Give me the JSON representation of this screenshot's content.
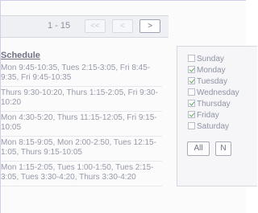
{
  "pager": {
    "range": "1 - 15",
    "first_icon": "double-chevron-left-icon",
    "prev_icon": "chevron-left-icon",
    "next_icon": "chevron-right-icon",
    "first_label": "<<",
    "prev_label": "<",
    "next_label": ">"
  },
  "schedule": {
    "header": "Schedule",
    "rows": [
      "Mon 9:45-10:35, Tues 2:15-3:05, Fri 8:45-9:35, Fri 9:45-10:35",
      "Thurs 9:30-10:20, Thurs 1:15-2:05, Fri 9:30-10:20",
      "Mon 4:30-5:20, Thurs 11:15-12:05, Fri 9:15-10:05",
      "Mon 8:15-9:05, Mon 2:00-2:50, Tues 12:15-1:05, Thurs 9:15-10:05",
      "Mon 1:15-2:05, Tues 1:00-1:50, Tues 2:15-3:05, Tues 3:30-4:20, Thurs 3:30-4:20"
    ]
  },
  "days": [
    {
      "label": "Sunday",
      "checked": false
    },
    {
      "label": "Monday",
      "checked": true
    },
    {
      "label": "Tuesday",
      "checked": true
    },
    {
      "label": "Wednesday",
      "checked": false
    },
    {
      "label": "Thursday",
      "checked": true
    },
    {
      "label": "Friday",
      "checked": true
    },
    {
      "label": "Saturday",
      "checked": false
    }
  ],
  "buttons": {
    "all": "All",
    "none": "N"
  }
}
